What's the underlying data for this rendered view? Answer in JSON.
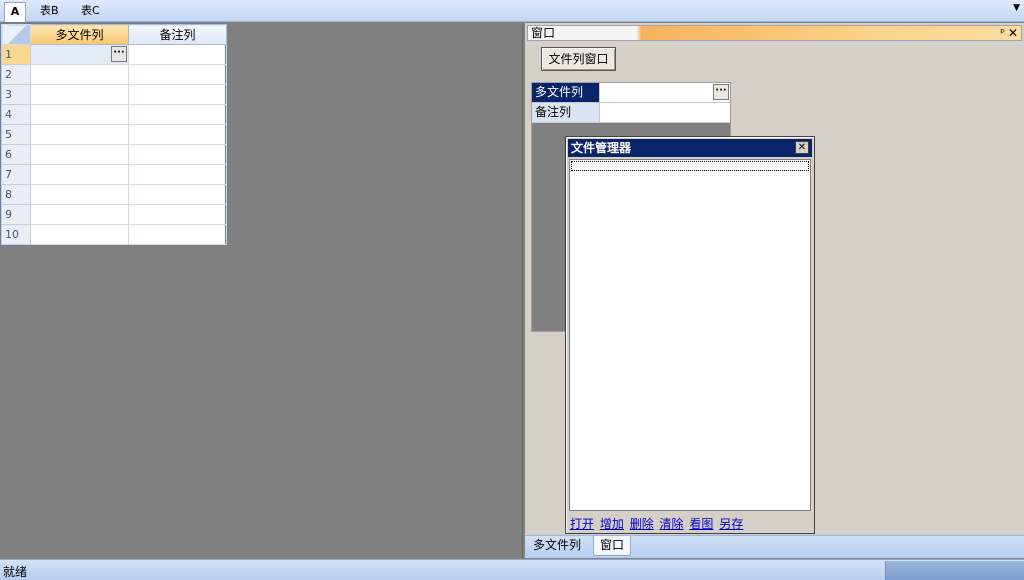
{
  "top_tabs": [
    {
      "label": "A"
    },
    {
      "label": "表B"
    },
    {
      "label": "表C"
    }
  ],
  "top_tabs_dropdown_icon": "▼",
  "grid": {
    "columns": [
      "多文件列",
      "备注列"
    ],
    "rows": [
      "1",
      "2",
      "3",
      "4",
      "5",
      "6",
      "7",
      "8",
      "9",
      "10"
    ],
    "ellipsis_label": "···"
  },
  "dock": {
    "title": "窗口",
    "pin_icon": "ᵖ",
    "close_icon": "✕",
    "open_button_label": "文件列窗口",
    "properties": [
      {
        "label": "多文件列",
        "value": ""
      },
      {
        "label": "备注列",
        "value": ""
      }
    ],
    "ellipsis_label": "···"
  },
  "file_manager": {
    "title": "文件管理器",
    "close_icon": "✕",
    "links": [
      "打开",
      "增加",
      "删除",
      "清除",
      "看图",
      "另存"
    ]
  },
  "dock_tabs": [
    "多文件列",
    "窗口"
  ],
  "status": {
    "text": "就绪"
  },
  "colors": {
    "selection_blue": "#0a246a",
    "header_orange": "#f9c86f",
    "workspace_gray": "#808080",
    "panel_gray": "#d4d0c8"
  }
}
